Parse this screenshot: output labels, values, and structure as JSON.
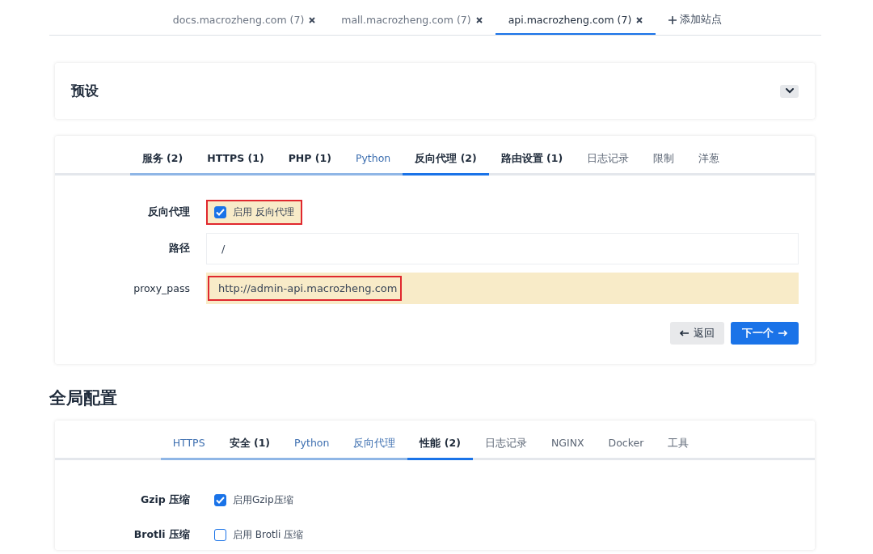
{
  "site_tabs": [
    {
      "label": "docs.macrozheng.com (7)",
      "selected": false
    },
    {
      "label": "mall.macrozheng.com (7)",
      "selected": false
    },
    {
      "label": "api.macrozheng.com (7)",
      "selected": true
    }
  ],
  "add_site": "添加站点",
  "presets": {
    "title": "预设",
    "expanded": false
  },
  "site_config": {
    "tabs": [
      {
        "label": "服务 (2)",
        "kind": "modified",
        "visited": true,
        "selected": false
      },
      {
        "label": "HTTPS (1)",
        "kind": "modified",
        "visited": true,
        "selected": false
      },
      {
        "label": "PHP (1)",
        "kind": "modified",
        "visited": true,
        "selected": false
      },
      {
        "label": "Python",
        "kind": "link",
        "visited": true,
        "selected": false
      },
      {
        "label": "反向代理 (2)",
        "kind": "modified",
        "visited": true,
        "selected": true
      },
      {
        "label": "路由设置 (1)",
        "kind": "modified",
        "visited": false,
        "selected": false
      },
      {
        "label": "日志记录",
        "kind": "plain",
        "visited": false,
        "selected": false
      },
      {
        "label": "限制",
        "kind": "plain",
        "visited": false,
        "selected": false
      },
      {
        "label": "洋葱",
        "kind": "plain",
        "visited": false,
        "selected": false
      }
    ],
    "fields": [
      {
        "kind": "checkbox",
        "label": "反向代理",
        "text": "启用 反向代理",
        "checked": true,
        "changed": true,
        "highlighted": true
      },
      {
        "kind": "text",
        "label": "路径",
        "value": "/",
        "changed": false,
        "highlighted": false
      },
      {
        "kind": "text",
        "label": "proxy_pass",
        "value": "http://admin-api.macrozheng.com",
        "changed": true,
        "highlighted": true
      }
    ],
    "back_button": "返回",
    "next_button": "下一个"
  },
  "global_title": "全局配置",
  "global_config": {
    "tabs": [
      {
        "label": "HTTPS",
        "kind": "link",
        "visited": true,
        "selected": false
      },
      {
        "label": "安全 (1)",
        "kind": "modified",
        "visited": true,
        "selected": false
      },
      {
        "label": "Python",
        "kind": "link",
        "visited": true,
        "selected": false
      },
      {
        "label": "反向代理",
        "kind": "link",
        "visited": true,
        "selected": false
      },
      {
        "label": "性能 (2)",
        "kind": "modified",
        "visited": true,
        "selected": true
      },
      {
        "label": "日志记录",
        "kind": "plain",
        "visited": false,
        "selected": false
      },
      {
        "label": "NGINX",
        "kind": "plain",
        "visited": false,
        "selected": false
      },
      {
        "label": "Docker",
        "kind": "plain",
        "visited": false,
        "selected": false
      },
      {
        "label": "工具",
        "kind": "plain",
        "visited": false,
        "selected": false
      }
    ],
    "fields": [
      {
        "kind": "checkbox",
        "label": "Gzip 压缩",
        "text": "启用Gzip压缩",
        "checked": true,
        "changed": false,
        "highlighted": false
      },
      {
        "kind": "checkbox",
        "label": "Brotli 压缩",
        "text": "启用 Brotli 压缩",
        "checked": false,
        "changed": false,
        "highlighted": false
      }
    ]
  }
}
